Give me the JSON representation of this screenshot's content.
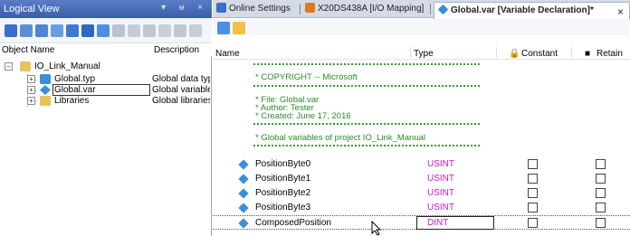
{
  "logical_view": {
    "title": "Logical View",
    "window_controls": "▾ ᵾ ×",
    "columns": {
      "object_name": "Object Name",
      "description": "Description"
    },
    "tree": [
      {
        "name": "IO_Link_Manual",
        "description": ""
      },
      {
        "name": "Global.typ",
        "description": "Global data typ"
      },
      {
        "name": "Global.var",
        "description": "Global variable"
      },
      {
        "name": "Libraries",
        "description": "Global libraries"
      }
    ]
  },
  "tabs": [
    {
      "label": "Online Settings"
    },
    {
      "label": "X20DS438A [I/O Mapping]"
    },
    {
      "label": "Global.var [Variable Declaration]*"
    }
  ],
  "tab_close": "×",
  "grid": {
    "columns": {
      "name": "Name",
      "type": "Type",
      "constant": "Constant",
      "retain": "Retain"
    },
    "comment_lines": [
      "* COPYRIGHT -- Microsoft",
      "* File: Global.var",
      "* Author: Tester",
      "* Created: June 17, 2016",
      "* Global variables of project IO_Link_Manual"
    ],
    "variables": [
      {
        "name": "PositionByte0",
        "type": "USINT"
      },
      {
        "name": "PositionByte1",
        "type": "USINT"
      },
      {
        "name": "PositionByte2",
        "type": "USINT"
      },
      {
        "name": "PositionByte3",
        "type": "USINT"
      },
      {
        "name": "ComposedPosition",
        "type": "DINT"
      }
    ]
  },
  "colors": {
    "title_bar": "#3a5ea9",
    "comment_green": "#2b8a2b",
    "type_magenta": "#c81ac8",
    "variable_icon": "#3a8fd9"
  }
}
